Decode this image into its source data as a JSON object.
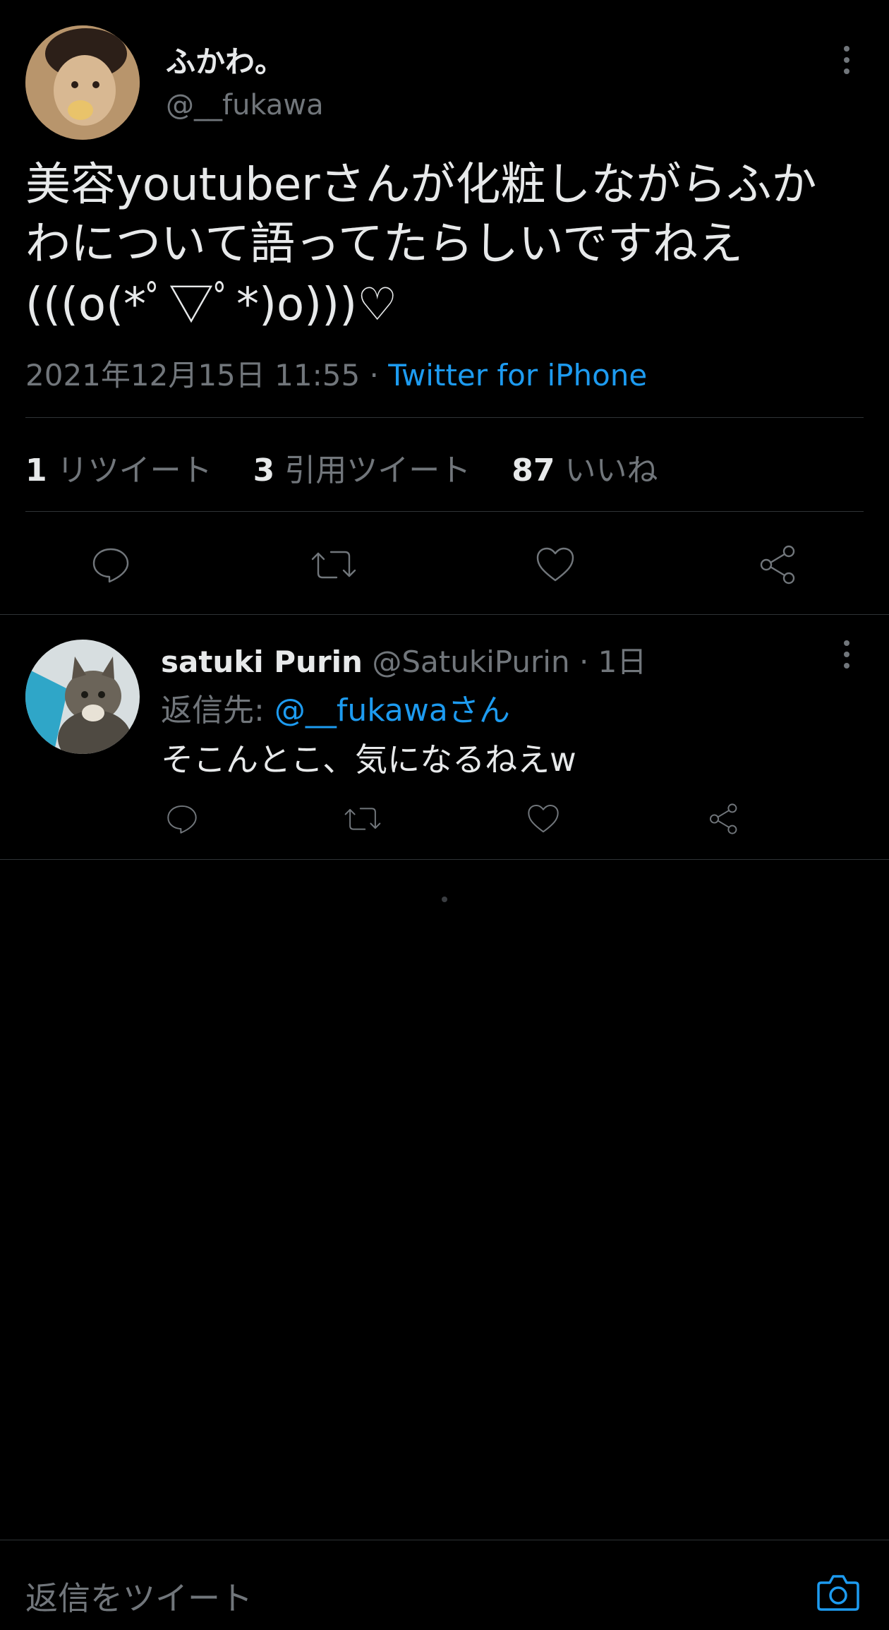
{
  "main_tweet": {
    "author_name": "ふかわ。",
    "author_handle": "@__fukawa",
    "text_line1": "美容youtuberさんが化粧しながらふか",
    "text_line2": "わについて語ってたらしいですねえ",
    "text_line3": "(((o(*ﾟ▽ﾟ*)o)))♡",
    "timestamp": "2021年12月15日 11:55",
    "separator": "·",
    "source": "Twitter for iPhone",
    "stats": {
      "retweets_count": "1",
      "retweets_label": "リツイート",
      "quotes_count": "3",
      "quotes_label": "引用ツイート",
      "likes_count": "87",
      "likes_label": "いいね"
    },
    "actions": [
      "reply-icon",
      "retweet-icon",
      "like-icon",
      "share-icon"
    ]
  },
  "reply": {
    "author_name": "satuki Purin",
    "author_handle": "@SatukiPurin",
    "time": "· 1日",
    "reply_to_label": "返信先:",
    "reply_to_handle": "@__fukawaさん",
    "text": "そこんとこ、気になるねえw"
  },
  "composer": {
    "placeholder": "返信をツイート"
  },
  "colors": {
    "background": "#000000",
    "text": "#e7e9ea",
    "muted": "#71767b",
    "accent": "#1d9bf0",
    "divider": "#2f3336"
  }
}
